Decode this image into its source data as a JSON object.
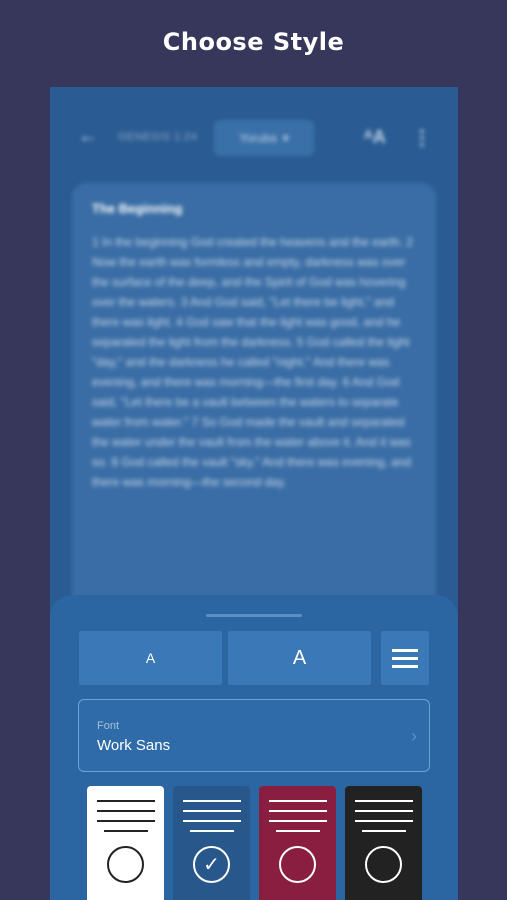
{
  "headline": "Choose Style",
  "reader": {
    "reference": "GENESIS 1:24",
    "language": "Yoruba",
    "language_caret": "▾",
    "back_icon": "←",
    "text_size_icon": "ᴬA",
    "more_icon": "⋮",
    "card_title": "The Beginning",
    "card_text": "1 In the beginning God created the heavens and the earth. 2 Now the earth was formless and empty, darkness was over the surface of the deep, and the Spirit of God was hovering over the waters. 3 And God said, \"Let there be light,\" and there was light. 4 God saw that the light was good, and he separated the light from the darkness. 5 God called the light \"day,\" and the darkness he called \"night.\" And there was evening, and there was morning—the first day. 6 And God said, \"Let there be a vault between the waters to separate water from water.\" 7 So God made the vault and separated the water under the vault from the water above it. And it was so. 8 God called the vault \"sky.\" And there was evening, and there was morning—the second day."
  },
  "sheet": {
    "small_label": "A",
    "large_label": "A",
    "font_label": "Font",
    "font_value": "Work Sans",
    "font_arrow": "›",
    "themes": [
      {
        "name": "light",
        "bg": "#ffffff",
        "fg": "#222222",
        "selected": false
      },
      {
        "name": "blue",
        "bg": "#28578c",
        "fg": "#ffffff",
        "selected": true,
        "check": "✓"
      },
      {
        "name": "red",
        "bg": "#8a1e40",
        "fg": "#ffffff",
        "selected": false
      },
      {
        "name": "dark",
        "bg": "#222222",
        "fg": "#ffffff",
        "selected": false
      }
    ]
  }
}
